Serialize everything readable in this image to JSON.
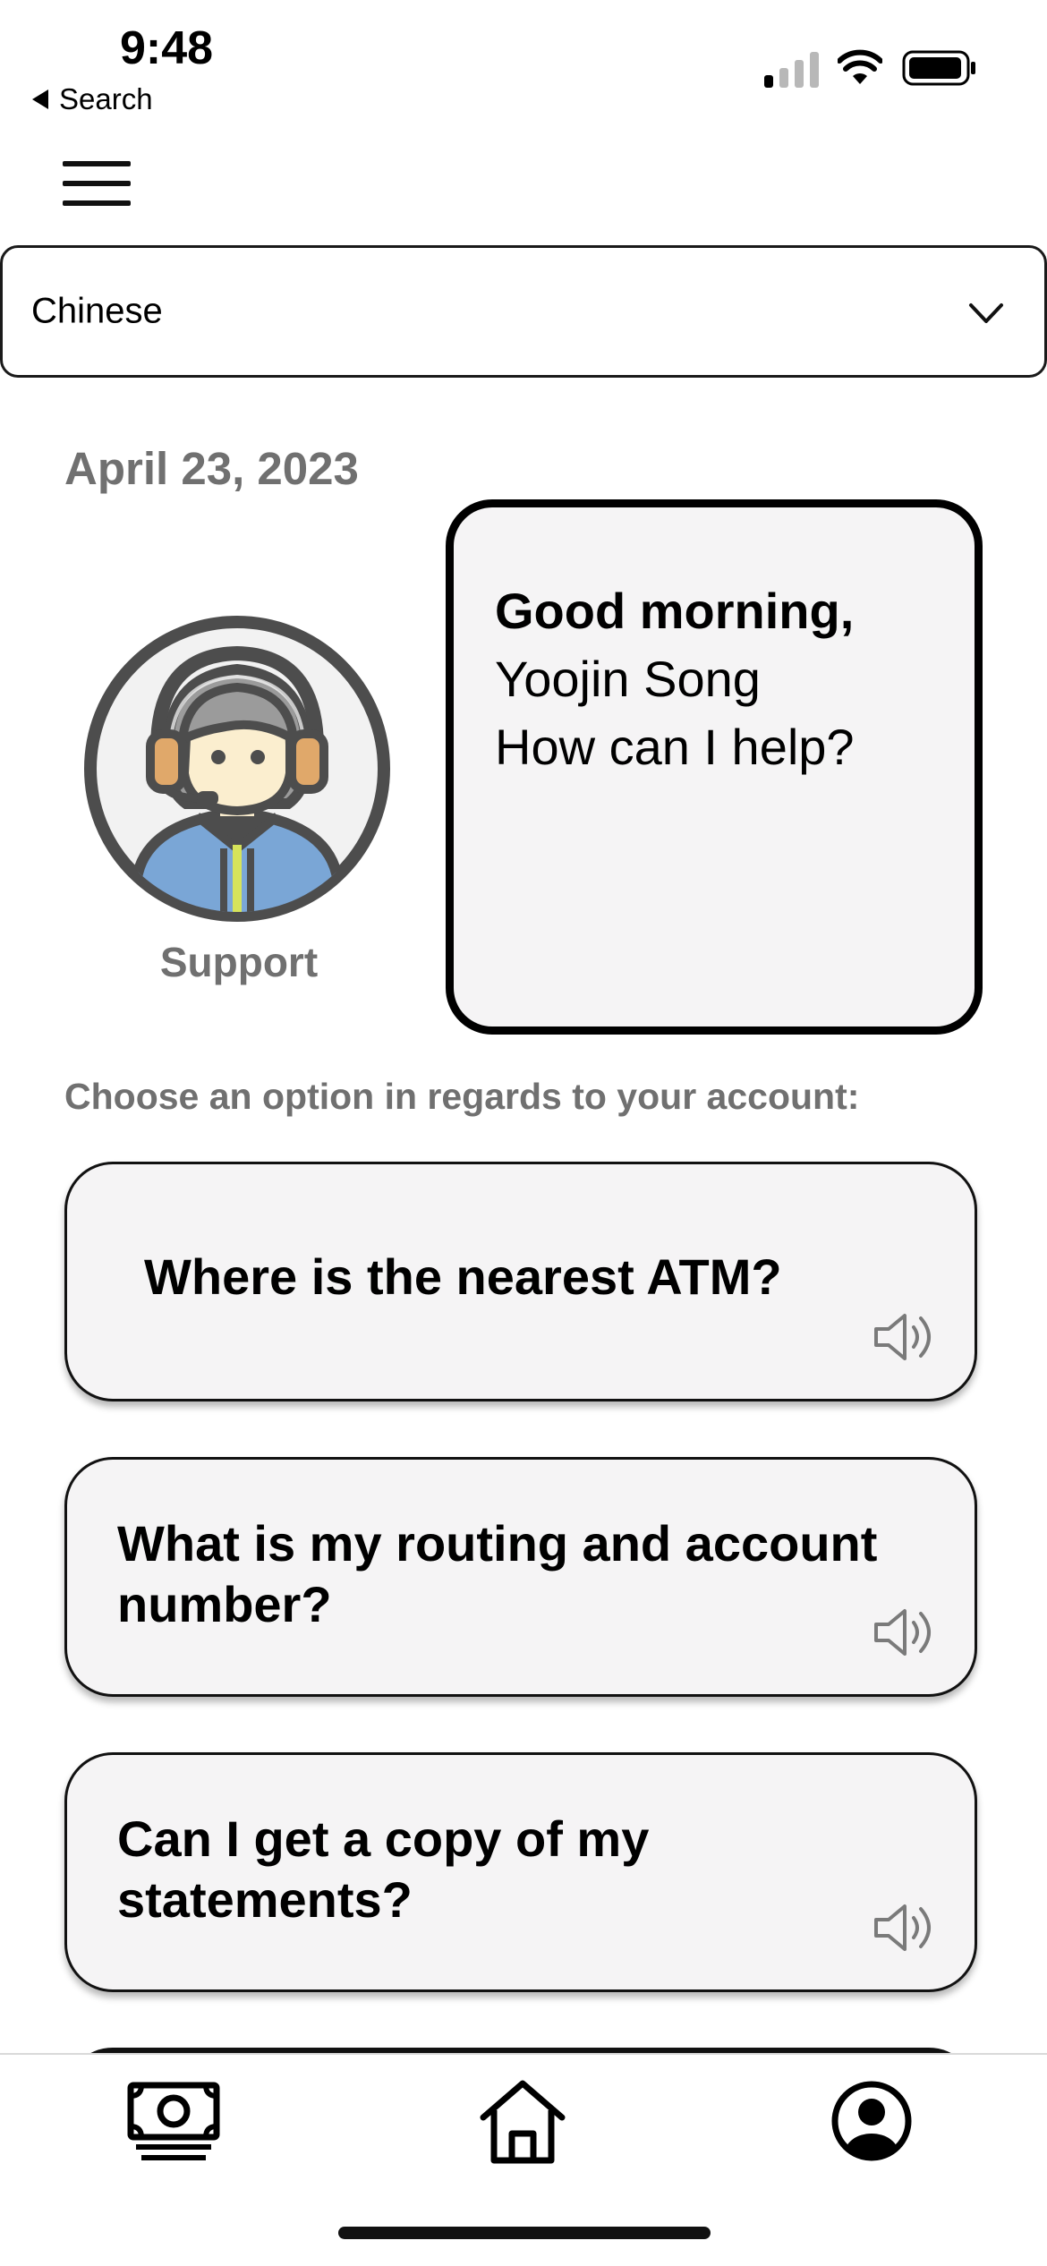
{
  "status_bar": {
    "time": "9:48",
    "back_label": "Search",
    "icons": [
      "cellular-signal-icon",
      "wifi-icon",
      "battery-icon"
    ]
  },
  "header": {
    "menu_icon": "hamburger-menu-icon"
  },
  "language_select": {
    "value": "Chinese",
    "icon": "chevron-down-icon"
  },
  "date": "April 23, 2023",
  "support": {
    "label": "Support",
    "avatar": "support-agent-avatar"
  },
  "greeting": {
    "line1": "Good morning,",
    "line2": "Yoojin Song",
    "line3": "How can I help?"
  },
  "prompt": "Choose an option in regards to your account:",
  "options": [
    {
      "text": "Where is the nearest ATM?",
      "icon": "speaker-icon"
    },
    {
      "text": "What is my routing and account number?",
      "icon": "speaker-icon"
    },
    {
      "text": "Can I get a copy of my statements?",
      "icon": "speaker-icon"
    }
  ],
  "tab_bar": {
    "items": [
      "money-icon",
      "home-icon",
      "profile-icon"
    ]
  },
  "colors": {
    "muted_text": "#707070",
    "card_bg": "#f5f4f5",
    "border": "#000000"
  }
}
